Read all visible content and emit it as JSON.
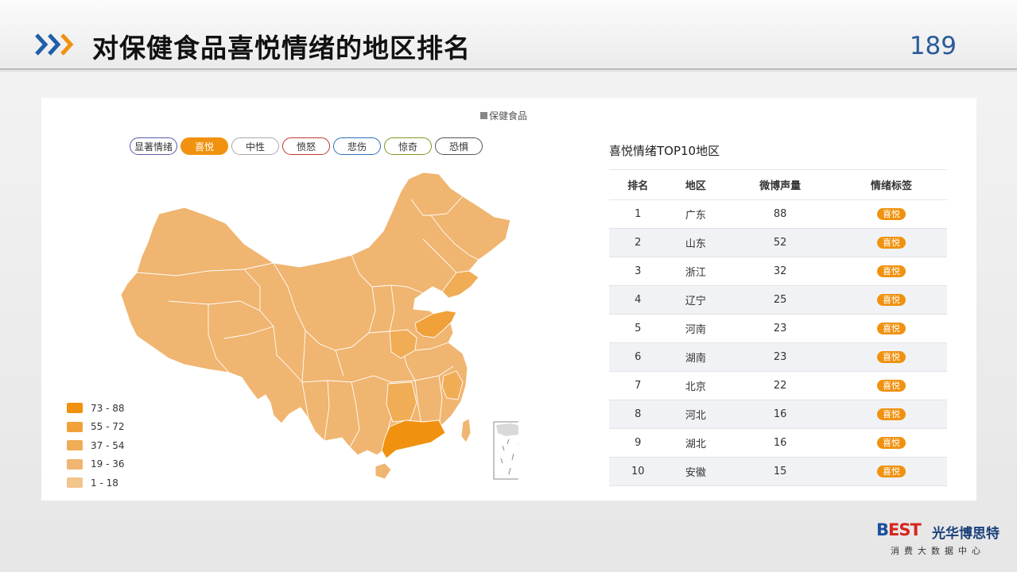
{
  "header": {
    "title": "对保健食品喜悦情绪的地区排名",
    "page_number": "189"
  },
  "series_legend": "保健食品",
  "emotion_tabs": [
    "显著情绪",
    "喜悦",
    "中性",
    "愤怒",
    "悲伤",
    "惊奇",
    "恐惧"
  ],
  "active_tab": "喜悦",
  "visual_map": {
    "ranges": [
      "73 - 88",
      "55 - 72",
      "37 - 54",
      "19 - 36",
      "1 - 18"
    ],
    "colors": [
      "#f0920f",
      "#f0a13a",
      "#f0ad56",
      "#f0b570",
      "#f3c48c"
    ]
  },
  "table": {
    "title": "喜悦情绪TOP10地区",
    "columns": [
      "排名",
      "地区",
      "微博声量",
      "情绪标签"
    ],
    "rows": [
      {
        "rank": "1",
        "region": "广东",
        "volume": "88",
        "tag": "喜悦"
      },
      {
        "rank": "2",
        "region": "山东",
        "volume": "52",
        "tag": "喜悦"
      },
      {
        "rank": "3",
        "region": "浙江",
        "volume": "32",
        "tag": "喜悦"
      },
      {
        "rank": "4",
        "region": "辽宁",
        "volume": "25",
        "tag": "喜悦"
      },
      {
        "rank": "5",
        "region": "河南",
        "volume": "23",
        "tag": "喜悦"
      },
      {
        "rank": "6",
        "region": "湖南",
        "volume": "23",
        "tag": "喜悦"
      },
      {
        "rank": "7",
        "region": "北京",
        "volume": "22",
        "tag": "喜悦"
      },
      {
        "rank": "8",
        "region": "河北",
        "volume": "16",
        "tag": "喜悦"
      },
      {
        "rank": "9",
        "region": "湖北",
        "volume": "16",
        "tag": "喜悦"
      },
      {
        "rank": "10",
        "region": "安徽",
        "volume": "15",
        "tag": "喜悦"
      }
    ]
  },
  "brand": {
    "logo_b": "B",
    "logo_est": "EST",
    "name": "光华博思特",
    "subtitle": "消费大数据中心"
  }
}
